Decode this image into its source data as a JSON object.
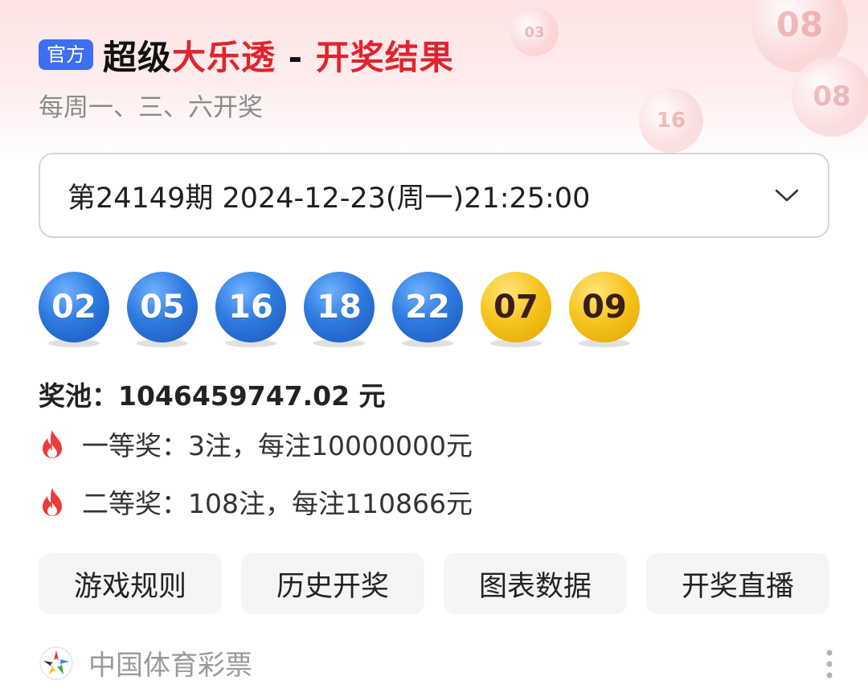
{
  "header": {
    "badge": "官方",
    "title_prefix": "超级",
    "title_red": "大乐透",
    "title_sep": " - ",
    "title_suffix": "开奖结果",
    "subtitle": "每周一、三、六开奖"
  },
  "deco_ball_labels": [
    "08",
    "03",
    "08",
    "16"
  ],
  "issue_select": {
    "value": "第24149期 2024-12-23(周一)21:25:00"
  },
  "draw": {
    "front_balls": [
      "02",
      "05",
      "16",
      "18",
      "22"
    ],
    "back_balls": [
      "07",
      "09"
    ]
  },
  "prizes": {
    "jackpot": "奖池：1046459747.02 元",
    "first": "一等奖：3注，每注10000000元",
    "second": "二等奖：108注，每注110866元"
  },
  "actions": {
    "rules": "游戏规则",
    "history": "历史开奖",
    "charts": "图表数据",
    "live": "开奖直播"
  },
  "footer": {
    "source": "中国体育彩票"
  },
  "colors": {
    "accent_red": "#e0242f",
    "badge_blue": "#3d6ff0",
    "front_ball_blue": "#2f7be0",
    "back_ball_yellow": "#f5c21a"
  }
}
